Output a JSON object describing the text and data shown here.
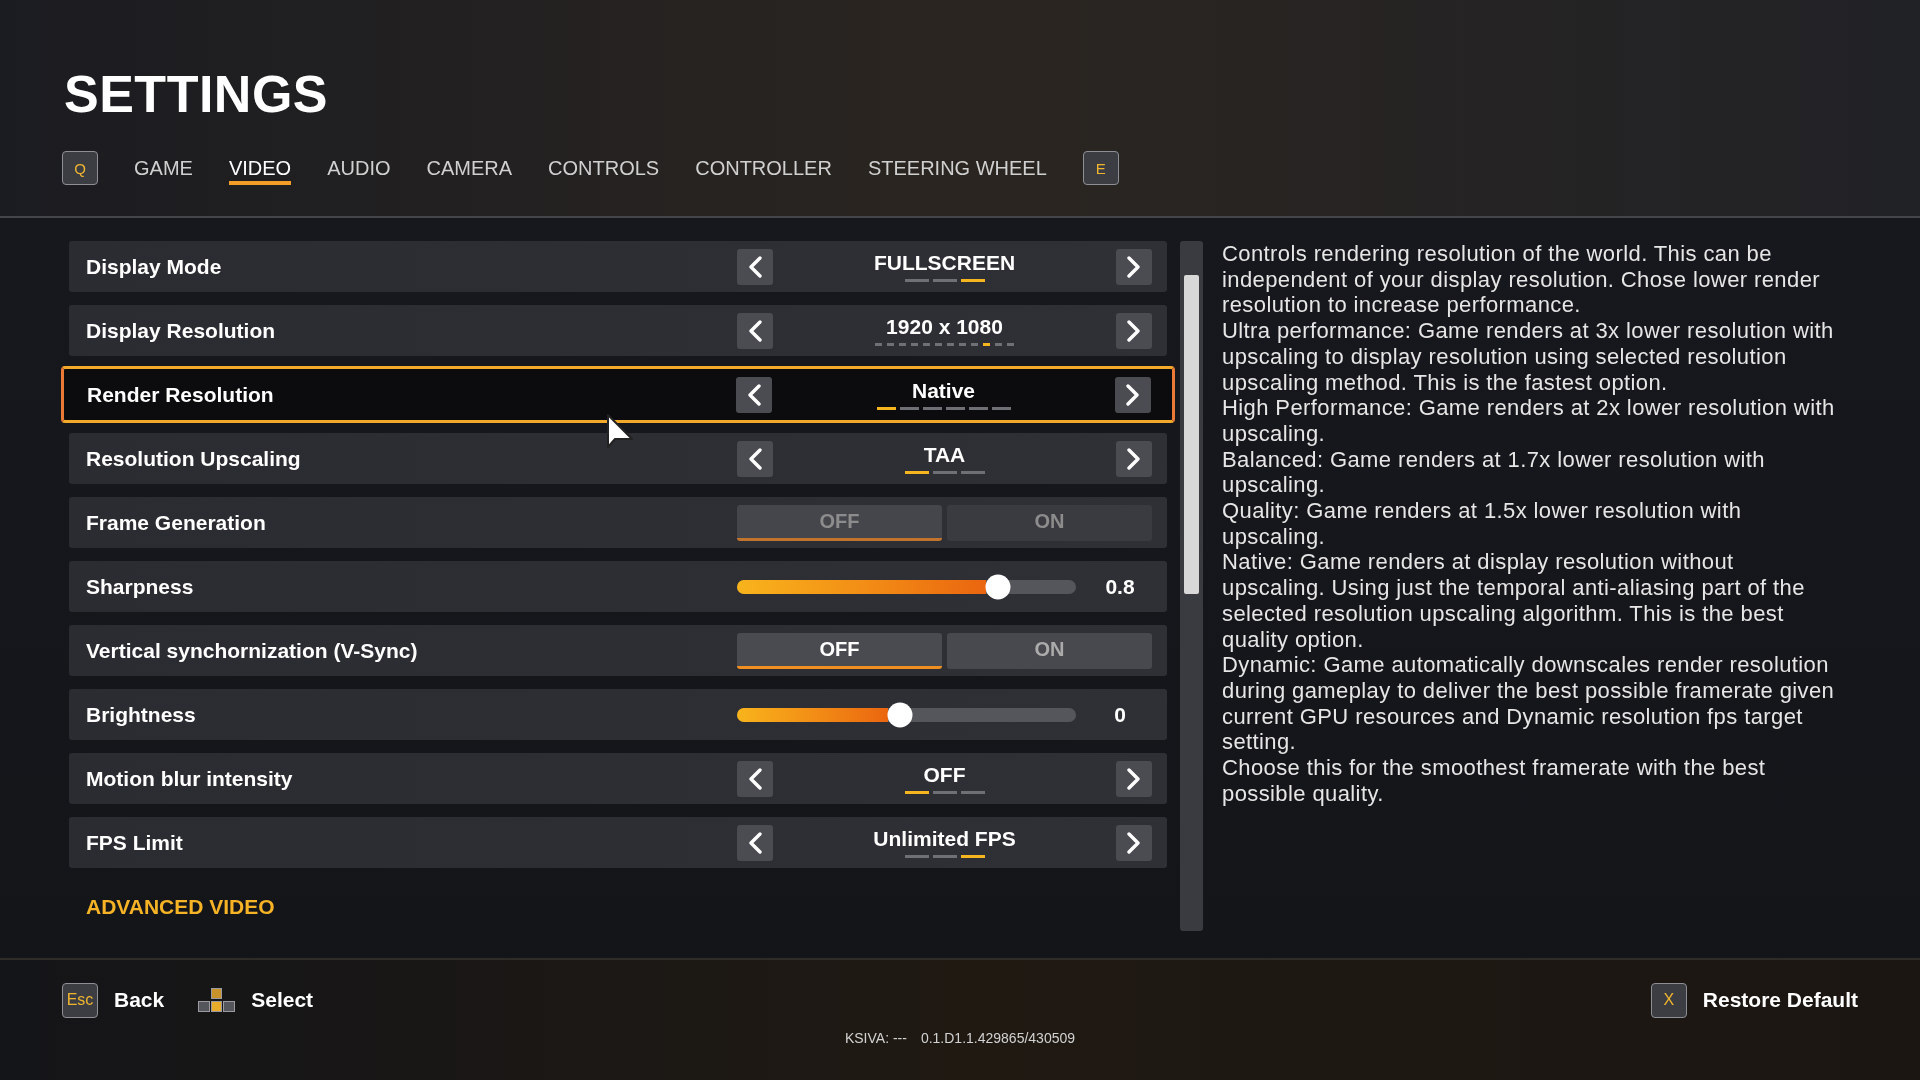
{
  "title": "SETTINGS",
  "tab_bar": {
    "prev_key": "Q",
    "next_key": "E",
    "tabs": [
      {
        "label": "GAME",
        "selected": false
      },
      {
        "label": "VIDEO",
        "selected": true
      },
      {
        "label": "AUDIO",
        "selected": false
      },
      {
        "label": "CAMERA",
        "selected": false
      },
      {
        "label": "CONTROLS",
        "selected": false
      },
      {
        "label": "CONTROLLER",
        "selected": false
      },
      {
        "label": "STEERING WHEEL",
        "selected": false
      }
    ]
  },
  "settings": [
    {
      "kind": "selector",
      "label": "Display Mode",
      "selected": false,
      "value": "FULLSCREEN",
      "steps": [
        {
          "selected": false
        },
        {
          "selected": false
        },
        {
          "selected": true
        }
      ]
    },
    {
      "kind": "selector",
      "label": "Display Resolution",
      "selected": false,
      "value": "1920 x 1080",
      "steps": [
        {
          "selected": false
        },
        {
          "selected": false
        },
        {
          "selected": false
        },
        {
          "selected": false
        },
        {
          "selected": false
        },
        {
          "selected": false
        },
        {
          "selected": false
        },
        {
          "selected": false
        },
        {
          "selected": false
        },
        {
          "selected": true
        },
        {
          "selected": false
        },
        {
          "selected": false
        }
      ]
    },
    {
      "kind": "selector",
      "label": "Render Resolution",
      "selected": true,
      "value": "Native",
      "steps": [
        {
          "selected": true
        },
        {
          "selected": false
        },
        {
          "selected": false
        },
        {
          "selected": false
        },
        {
          "selected": false
        },
        {
          "selected": false
        }
      ]
    },
    {
      "kind": "selector",
      "label": "Resolution Upscaling",
      "selected": false,
      "value": "TAA",
      "steps": [
        {
          "selected": true
        },
        {
          "selected": false
        },
        {
          "selected": false
        }
      ]
    },
    {
      "kind": "toggle",
      "label": "Frame Generation",
      "selected": false,
      "disabled": true,
      "options": [
        {
          "label": "OFF",
          "selected": true
        },
        {
          "label": "ON",
          "selected": false
        }
      ]
    },
    {
      "kind": "slider",
      "label": "Sharpness",
      "selected": false,
      "level": 0.77,
      "reading": "0.8"
    },
    {
      "kind": "toggle",
      "label": "Vertical synchornization (V-Sync)",
      "selected": false,
      "disabled": false,
      "options": [
        {
          "label": "OFF",
          "selected": true
        },
        {
          "label": "ON",
          "selected": false
        }
      ]
    },
    {
      "kind": "slider",
      "label": "Brightness",
      "selected": false,
      "level": 0.48,
      "reading": "0"
    },
    {
      "kind": "selector",
      "label": "Motion blur intensity",
      "selected": false,
      "value": "OFF",
      "steps": [
        {
          "selected": true
        },
        {
          "selected": false
        },
        {
          "selected": false
        }
      ]
    },
    {
      "kind": "selector",
      "label": "FPS Limit",
      "selected": false,
      "value": "Unlimited FPS",
      "steps": [
        {
          "selected": false
        },
        {
          "selected": false
        },
        {
          "selected": true
        }
      ]
    }
  ],
  "section_link": "ADVANCED VIDEO",
  "description": [
    "Controls rendering resolution of the world. This can be independent of your display resolution. Chose lower render resolution to increase performance.",
    "Ultra performance: Game renders at 3x lower resolution with upscaling to display resolution using selected resolution upscaling method. This is the fastest option.",
    "High Performance: Game renders at 2x lower resolution with upscaling.",
    "Balanced: Game renders at 1.7x lower resolution with upscaling.",
    "Quality: Game renders at 1.5x lower resolution with upscaling.",
    "Native: Game renders at display resolution without upscaling. Using just the temporal anti-aliasing part of the selected resolution upscaling algorithm. This is the best quality option.",
    "Dynamic: Game automatically downscales render resolution during gameplay to deliver the best possible framerate given current GPU resources and Dynamic resolution fps target setting.",
    "Choose this for the smoothest framerate with the best possible quality."
  ],
  "footer": {
    "hints": [
      {
        "kind": "key",
        "key": "Esc",
        "label": "Back"
      },
      {
        "kind": "icon",
        "label": "Select"
      }
    ],
    "restore": {
      "key": "X",
      "label": "Restore Default"
    },
    "build_info": [
      "KSIVA: ---",
      "0.1.D1.1.429865/430509"
    ]
  }
}
